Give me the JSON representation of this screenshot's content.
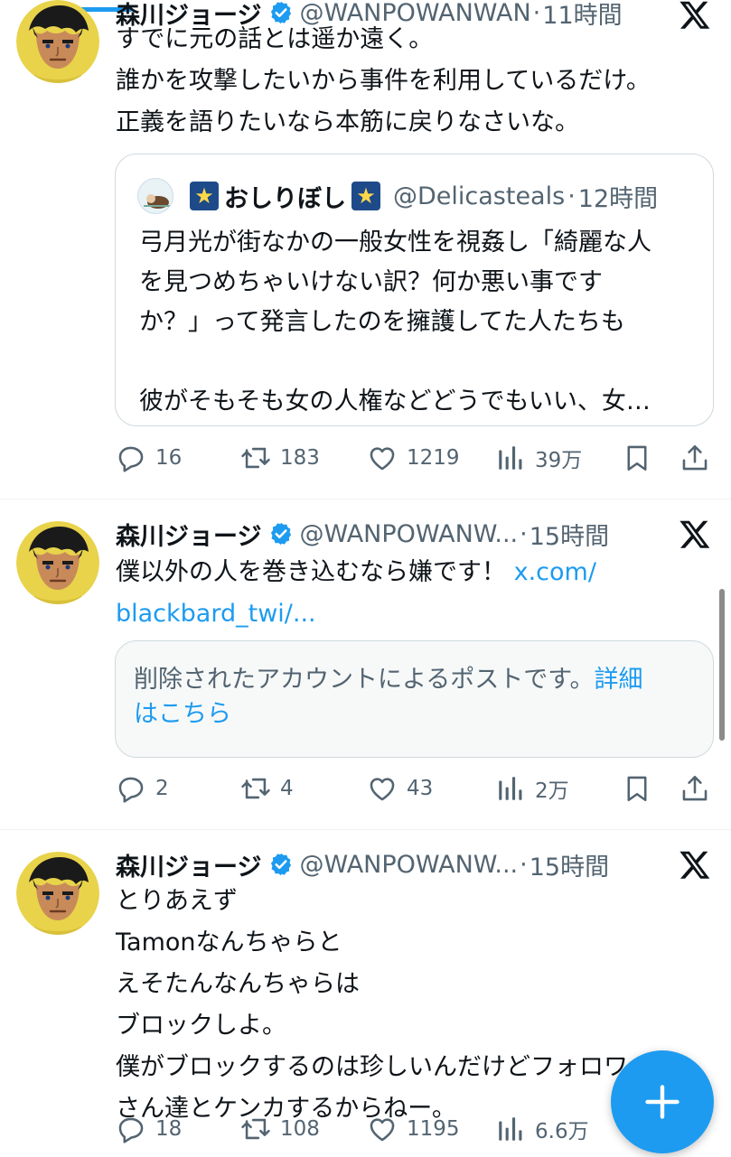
{
  "posts": [
    {
      "author": "森川ジョージ",
      "handle": "@WANPOWANWAN",
      "dot": "·",
      "time": "11時間",
      "text_lines": [
        "すでに元の話とは遥か遠く。",
        "誰かを攻撃したいから事件を利用しているだけ。",
        "正義を語りたいなら本筋に戻りなさいな。"
      ],
      "quote": {
        "name": "おしりぼし",
        "star": "★",
        "handle": "@Delicasteals",
        "dot": "·",
        "time": "12時間",
        "text_lines": [
          "弓月光が街なかの一般女性を視姦し「綺麗な人",
          "を見つめちゃいけない訳？何か悪い事です",
          "か？」って発言したのを擁護してた人たちも",
          "",
          "彼がそもそも女の人権などどうでもいい、女…"
        ]
      },
      "replies": "16",
      "reposts": "183",
      "likes": "1219",
      "views": "39万"
    },
    {
      "author": "森川ジョージ",
      "handle": "@WANPOWANW...",
      "dot": "·",
      "time": "15時間",
      "text_prefix": "僕以外の人を巻き込むなら嫌です！",
      "link_part1": "x.com/",
      "link_part2": "blackbard_twi/...",
      "deleted_notice": "削除されたアカウントによるポストです。",
      "deleted_link_part1": "詳細",
      "deleted_link_part2": "はこちら",
      "replies": "2",
      "reposts": "4",
      "likes": "43",
      "views": "2万"
    },
    {
      "author": "森川ジョージ",
      "handle": "@WANPOWANW...",
      "dot": "·",
      "time": "15時間",
      "text_lines": [
        "とりあえず",
        "Tamonなんちゃらと",
        "えそたんなんちゃらは",
        "ブロックしよ。",
        "僕がブロックするのは珍しいんだけどフォロワー",
        "さん達とケンカするからねー。"
      ],
      "replies": "18",
      "reposts": "108",
      "likes": "1195",
      "views": "6.6万"
    }
  ],
  "fab": {
    "icon": "plus-icon"
  },
  "colors": {
    "accent": "#1d9bf0",
    "muted": "#536471",
    "text": "#0f1419"
  }
}
